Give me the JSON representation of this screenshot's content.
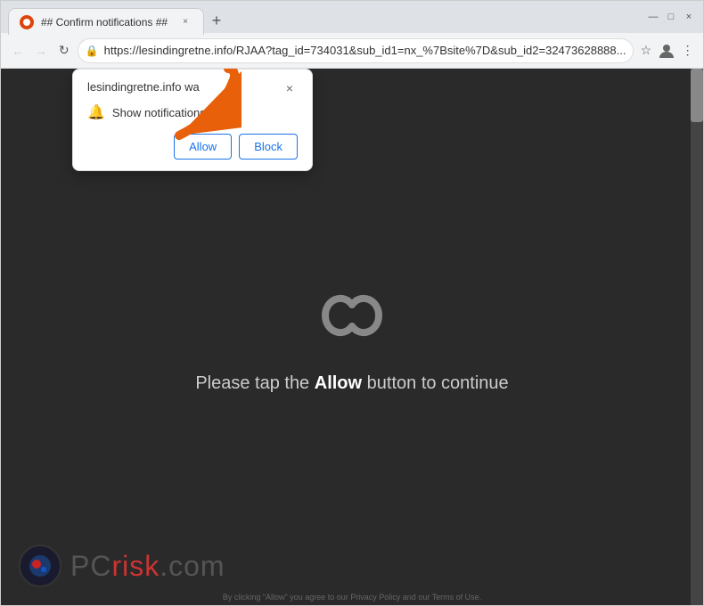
{
  "browser": {
    "tab": {
      "title": "## Confirm notifications ##",
      "close_label": "×"
    },
    "new_tab_label": "+",
    "window_controls": {
      "minimize": "—",
      "maximize": "□",
      "close": "×"
    },
    "address_bar": {
      "url": "https://lesindingretne.info/RJAA?tag_id=734031&sub_id1=nx_%7Bsite%7D&sub_id2=32473628888...",
      "lock_symbol": "🔒"
    },
    "nav": {
      "back": "←",
      "forward": "→",
      "refresh": "↻"
    }
  },
  "notification_popup": {
    "site_text": "lesindingretne.info wa",
    "notification_label": "Show notifications",
    "allow_label": "Allow",
    "block_label": "Block",
    "close_label": "×"
  },
  "page": {
    "message_prefix": "Please tap the ",
    "message_highlight": "Allow",
    "message_suffix": " button to continue"
  },
  "watermark": {
    "site": "pcrisk.com",
    "icon": "🔵"
  },
  "disclaimer": "By clicking \"Allow\" you agree to our Privacy Policy and our Terms of Use."
}
